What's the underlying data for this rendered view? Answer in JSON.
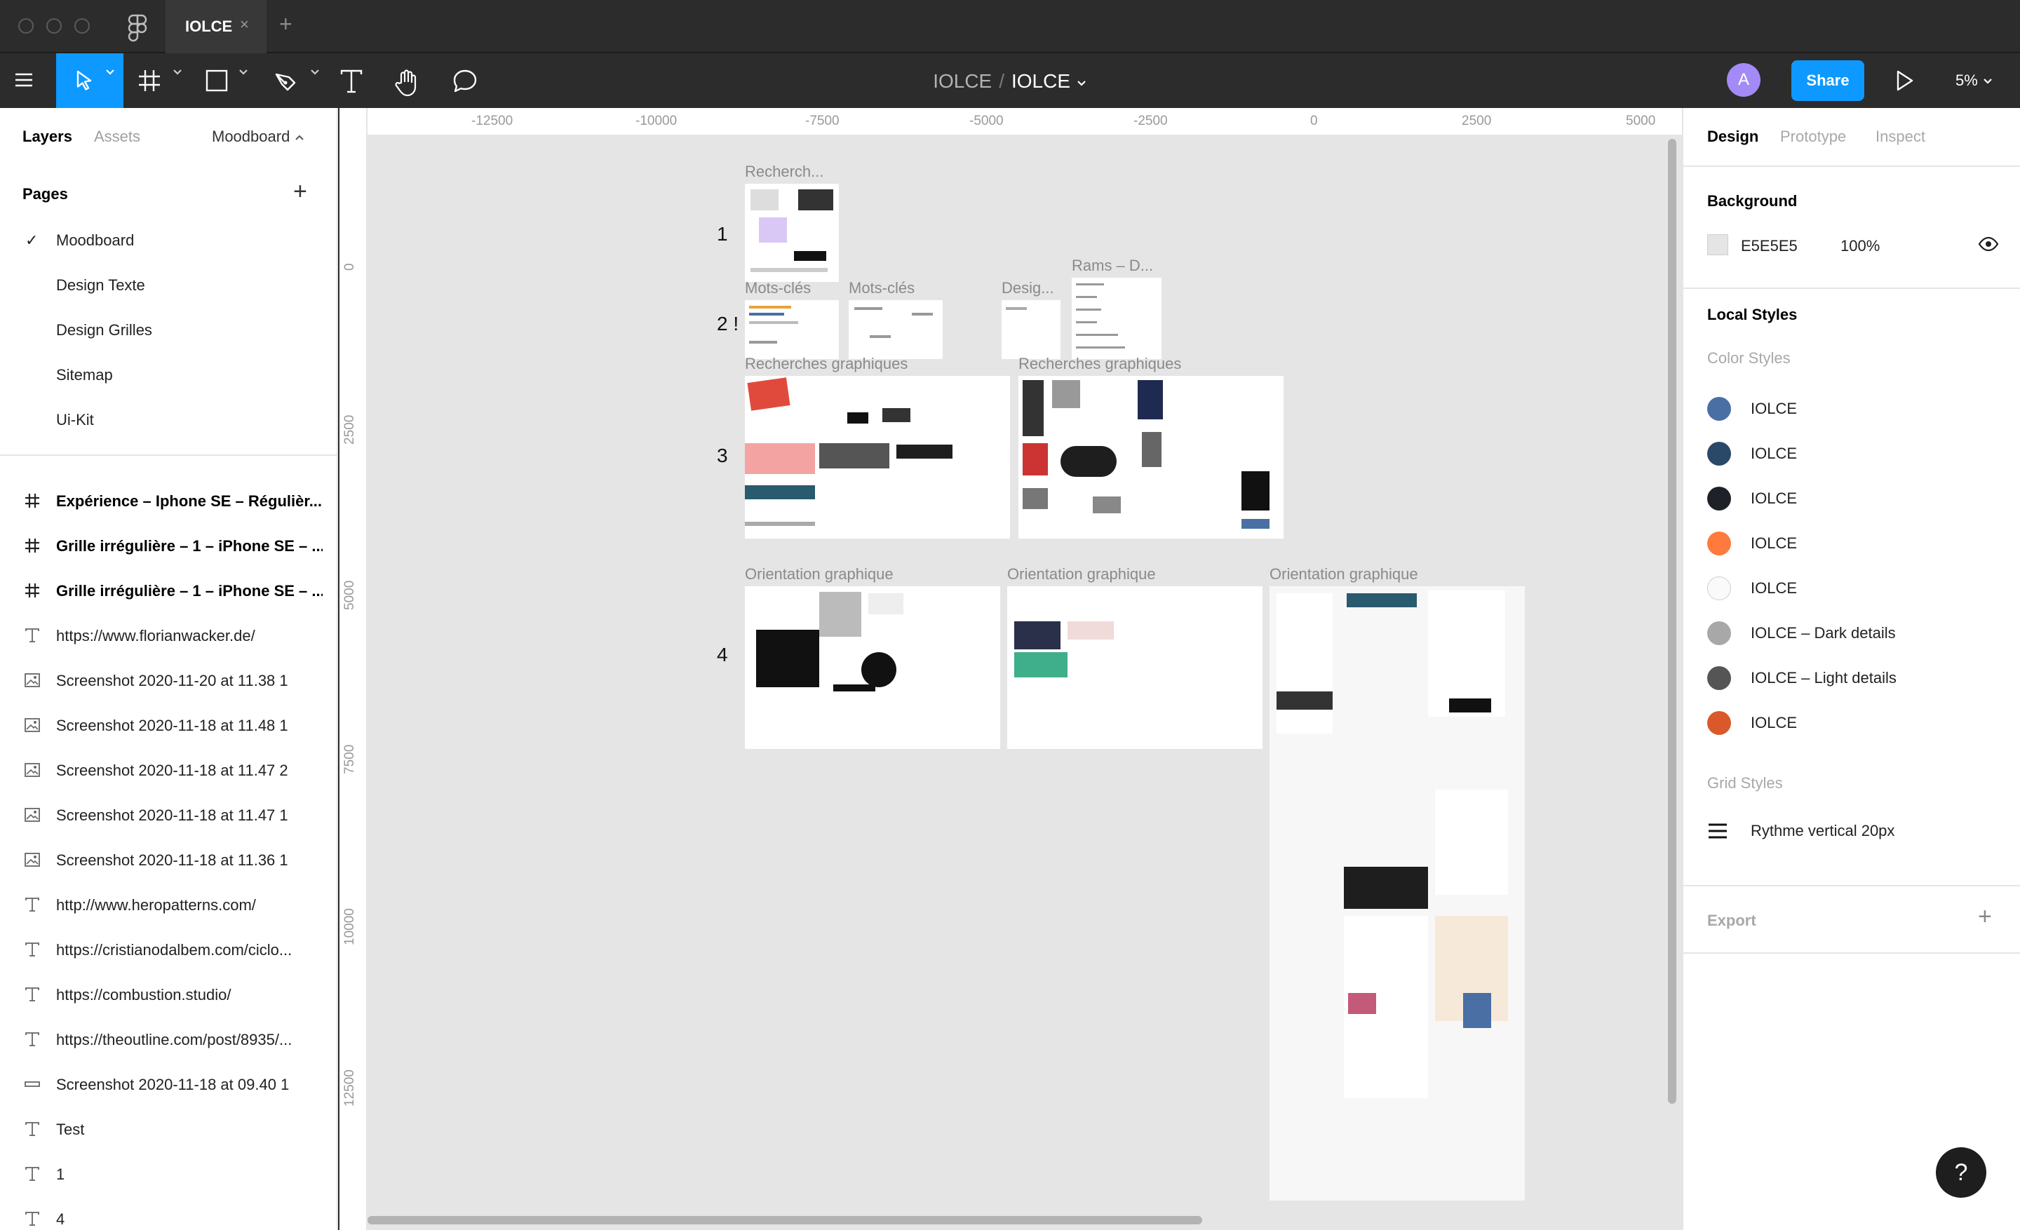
{
  "tab": {
    "title": "IOLCE",
    "close": "×",
    "new": "+"
  },
  "toolbar": {
    "project": "IOLCE",
    "separator": "/",
    "file": "IOLCE",
    "avatar_initial": "A",
    "share_label": "Share",
    "zoom": "5%"
  },
  "left_panel": {
    "tabs": {
      "layers": "Layers",
      "assets": "Assets"
    },
    "current_page": "Moodboard",
    "pages_header": "Pages",
    "pages_add": "+",
    "check": "✓",
    "pages": [
      "Moodboard",
      "Design Texte",
      "Design Grilles",
      "Sitemap",
      "Ui-Kit"
    ],
    "layers": [
      {
        "type": "frame",
        "label": "Expérience – Iphone SE – Régulièr..."
      },
      {
        "type": "frame",
        "label": "Grille irrégulière – 1 – iPhone SE – ..."
      },
      {
        "type": "frame",
        "label": "Grille irrégulière – 1 – iPhone SE – ..."
      },
      {
        "type": "text",
        "label": "https://www.florianwacker.de/"
      },
      {
        "type": "image",
        "label": "Screenshot 2020-11-20 at 11.38 1"
      },
      {
        "type": "image",
        "label": "Screenshot 2020-11-18 at 11.48 1"
      },
      {
        "type": "image",
        "label": "Screenshot 2020-11-18 at 11.47 2"
      },
      {
        "type": "image",
        "label": "Screenshot 2020-11-18 at 11.47 1"
      },
      {
        "type": "image",
        "label": "Screenshot 2020-11-18 at 11.36 1"
      },
      {
        "type": "text",
        "label": "http://www.heropatterns.com/"
      },
      {
        "type": "text",
        "label": "https://cristianodalbem.com/ciclo..."
      },
      {
        "type": "text",
        "label": "https://combustion.studio/"
      },
      {
        "type": "text",
        "label": "https://theoutline.com/post/8935/..."
      },
      {
        "type": "rect",
        "label": "Screenshot 2020-11-18 at 09.40 1"
      },
      {
        "type": "text",
        "label": "Test"
      },
      {
        "type": "text",
        "label": "1"
      },
      {
        "type": "text",
        "label": "4"
      }
    ]
  },
  "canvas": {
    "ruler_h": [
      "-12500",
      "-10000",
      "-7500",
      "-5000",
      "-2500",
      "0",
      "2500",
      "5000"
    ],
    "ruler_v": [
      "0",
      "2500",
      "5000",
      "7500",
      "10000",
      "12500"
    ],
    "row_numbers": [
      "1",
      "2 !",
      "3",
      "4"
    ],
    "frames": [
      "Recherch...",
      "Mots-clés",
      "Mots-clés",
      "Desig...",
      "Rams – D...",
      "Recherches graphiques",
      "Recherches graphiques",
      "Orientation graphique",
      "Orientation graphique",
      "Orientation graphique"
    ]
  },
  "right_panel": {
    "tabs": {
      "design": "Design",
      "prototype": "Prototype",
      "inspect": "Inspect"
    },
    "background": {
      "title": "Background",
      "hex": "E5E5E5",
      "opacity": "100%"
    },
    "local_styles": "Local Styles",
    "color_styles_title": "Color Styles",
    "color_styles": [
      {
        "name": "IOLCE",
        "color": "#4a6fa5"
      },
      {
        "name": "IOLCE",
        "color": "#2a4868"
      },
      {
        "name": "IOLCE",
        "color": "#1e2228"
      },
      {
        "name": "IOLCE",
        "color": "#ff7a3d"
      },
      {
        "name": "IOLCE",
        "color": "#fafafa"
      },
      {
        "name": "IOLCE – Dark details",
        "color": "#a8a8a8"
      },
      {
        "name": "IOLCE – Light details",
        "color": "#555555"
      },
      {
        "name": "IOLCE",
        "color": "#d9592a"
      }
    ],
    "grid_styles_title": "Grid Styles",
    "grid_style": "Rythme vertical 20px",
    "export": "Export",
    "export_add": "+"
  },
  "help": "?",
  "colors": {
    "accent": "#0d99ff",
    "canvas_bg": "#e5e5e5",
    "chrome": "#2c2c2c"
  }
}
